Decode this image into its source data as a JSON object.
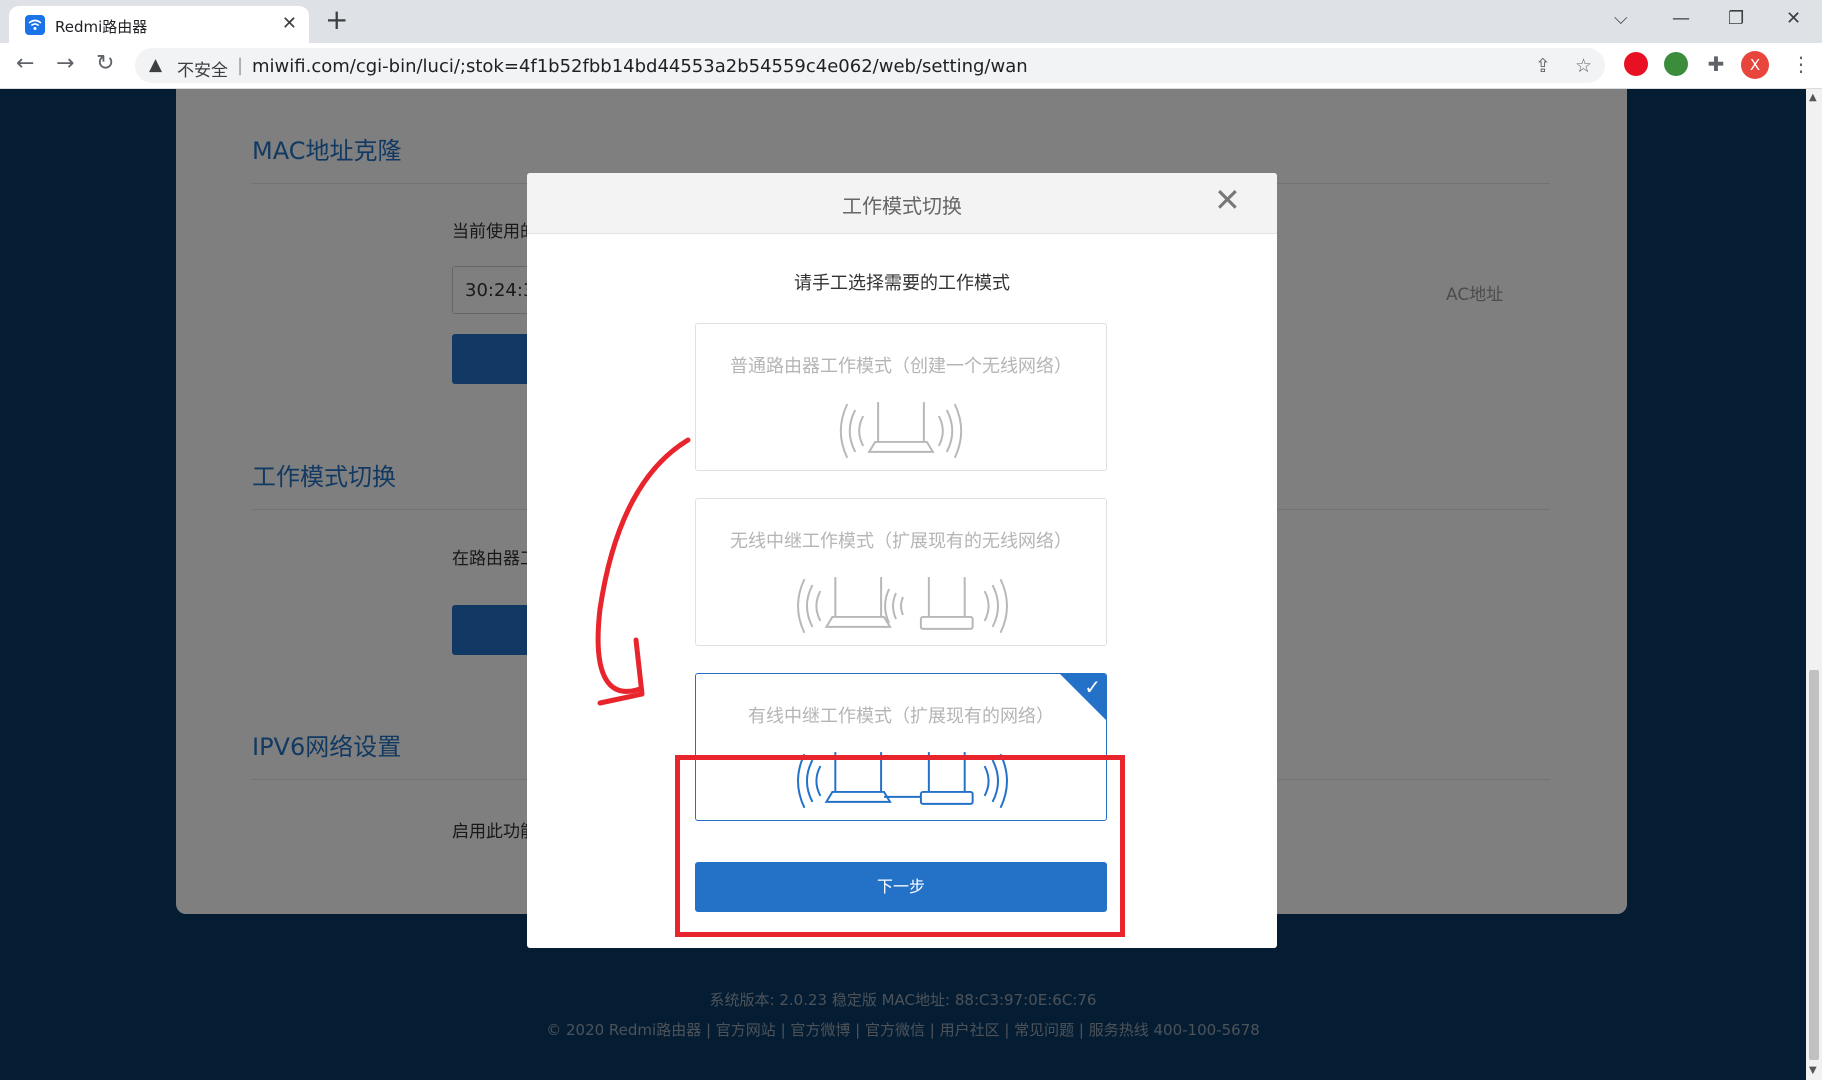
{
  "browser": {
    "tab_title": "Redmi路由器",
    "tab_close": "✕",
    "new_tab": "+",
    "window_minimize": "—",
    "window_restore": "❐",
    "window_close": "✕",
    "security_label": "不安全",
    "url": "miwifi.com/cgi-bin/luci/;stok=4f1b52fbb14bd44553a2b54559c4e062/web/setting/wan",
    "profile_initial": "X"
  },
  "page": {
    "mac_section_title": "MAC地址克隆",
    "mac_current_label": "当前使用的",
    "mac_value": "30:24:3",
    "mac_hint": "AC地址",
    "mode_section_title": "工作模式切换",
    "mode_section_text": "在路由器工",
    "ipv6_section_title": "IPV6网络设置",
    "ipv6_text": "启用此功能"
  },
  "footer": {
    "version_line": "系统版本: 2.0.23 稳定版  MAC地址: 88:C3:97:0E:6C:76",
    "links_line": "© 2020 Redmi路由器   |   官方网站   |   官方微博   |   官方微信   |   用户社区   |   常见问题   |   服务热线 400-100-5678"
  },
  "modal": {
    "title": "工作模式切换",
    "close": "✕",
    "prompt": "请手工选择需要的工作模式",
    "modes": [
      {
        "label": "普通路由器工作模式（创建一个无线网络）",
        "selected": false
      },
      {
        "label": "无线中继工作模式（扩展现有的无线网络）",
        "selected": false
      },
      {
        "label": "有线中继工作模式（扩展现有的网络）",
        "selected": true
      }
    ],
    "next_button": "下一步"
  },
  "colors": {
    "accent": "#2472c8",
    "annotation": "#e8252c",
    "page_bg": "#0a3a66"
  }
}
